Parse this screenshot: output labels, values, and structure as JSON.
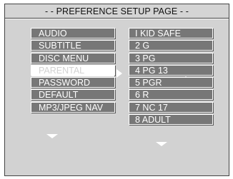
{
  "header": {
    "title": "- - PREFERENCE SETUP PAGE - -"
  },
  "menu": {
    "items": [
      {
        "label": "AUDIO"
      },
      {
        "label": "SUBTITLE"
      },
      {
        "label": "DISC MENU"
      },
      {
        "label": "PARENTAL"
      },
      {
        "label": "PASSWORD"
      },
      {
        "label": "DEFAULT"
      },
      {
        "label": "MP3/JPEG NAV"
      }
    ],
    "selected": "PARENTAL"
  },
  "submenu": {
    "items": [
      {
        "label": "I KID SAFE"
      },
      {
        "label": "2 G"
      },
      {
        "label": "3 PG"
      },
      {
        "label": "4 PG 13"
      },
      {
        "label": "5 PGR"
      },
      {
        "label": "6 R"
      },
      {
        "label": "7 NC 17"
      },
      {
        "label": "8 ADULT"
      }
    ]
  },
  "icons": {
    "submenu_arrow": "arrow-right-icon",
    "scroll_left": "scroll-down-icon",
    "scroll_right": "scroll-down-icon"
  },
  "colors": {
    "background": "#d2d2d2",
    "item": "#777777",
    "selected": "#ffffff",
    "title_bar": "#d4d4d4"
  }
}
